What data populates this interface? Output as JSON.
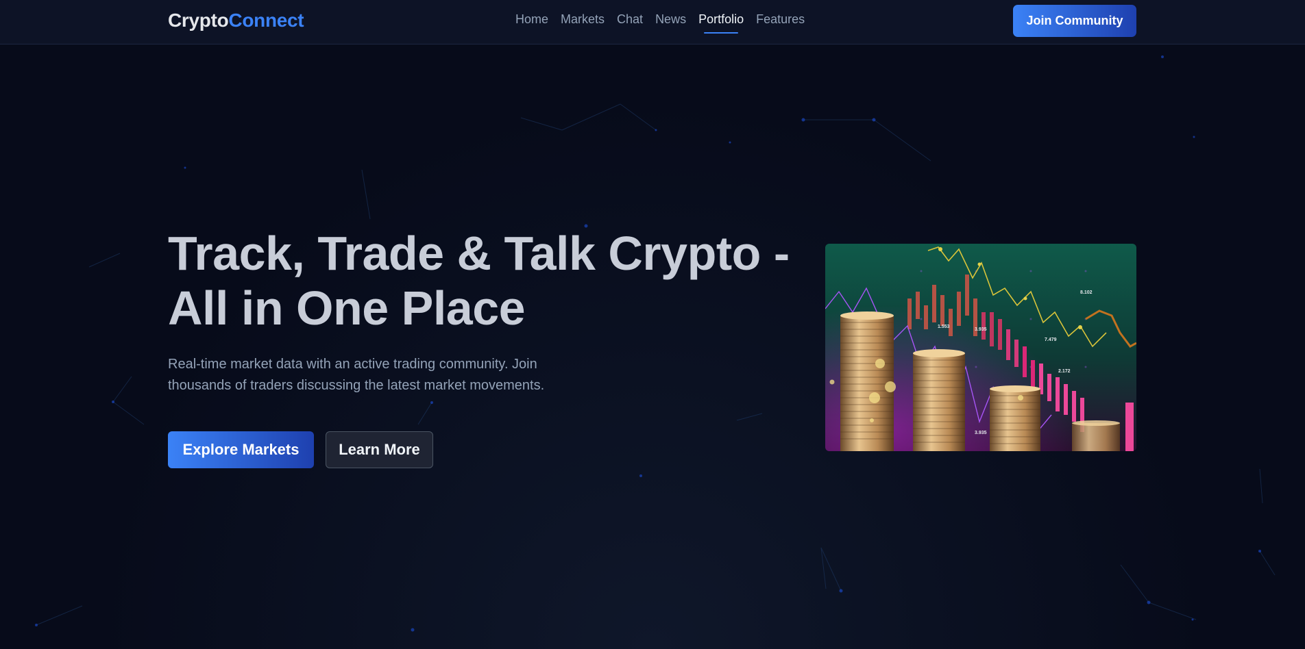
{
  "brand": {
    "name_part1": "Crypto",
    "name_part2": "Connect"
  },
  "nav": {
    "items": [
      {
        "label": "Home",
        "active": false
      },
      {
        "label": "Markets",
        "active": false
      },
      {
        "label": "Chat",
        "active": false
      },
      {
        "label": "News",
        "active": false
      },
      {
        "label": "Portfolio",
        "active": true
      },
      {
        "label": "Features",
        "active": false
      }
    ]
  },
  "header": {
    "join_label": "Join Community"
  },
  "hero": {
    "title": "Track, Trade & Talk Crypto - All in One Place",
    "subtitle": "Real-time market data with an active trading community. Join thousands of traders discussing the latest market movements.",
    "primary_cta": "Explore Markets",
    "secondary_cta": "Learn More",
    "image": {
      "description_icon": "crypto-coins-chart-image",
      "chart_labels": [
        "8.102",
        "7.479",
        "2.172",
        "3.935",
        "1.553",
        "3.935"
      ]
    }
  },
  "colors": {
    "accent": "#3b82f6",
    "accent_dark": "#1e40af",
    "background": "#070b1a",
    "header_bg": "#0d1326"
  }
}
